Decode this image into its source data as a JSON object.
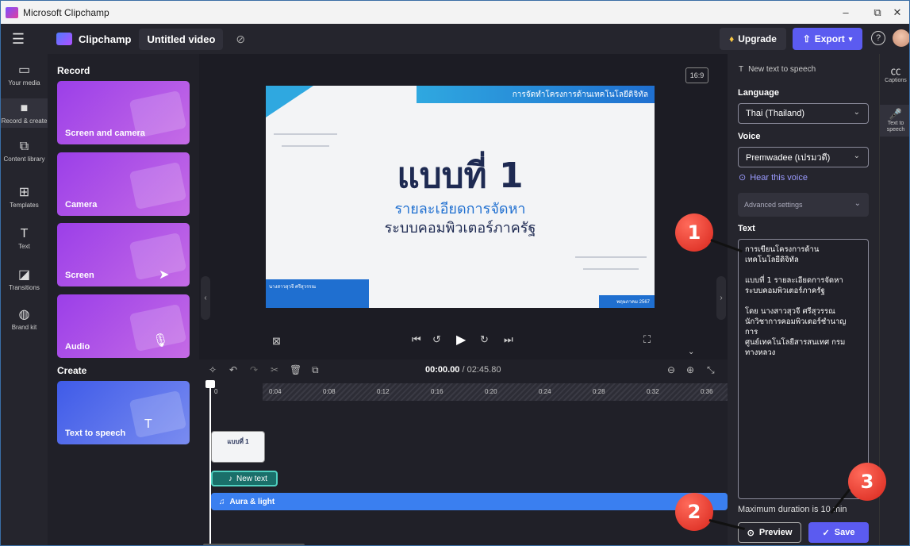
{
  "window": {
    "title": "Microsoft Clipchamp",
    "min": "–",
    "max": "⧉",
    "close": "✕"
  },
  "appbar": {
    "brand": "Clipchamp",
    "video_title": "Untitled video",
    "upgrade": "Upgrade",
    "export": "Export"
  },
  "left_rail": [
    {
      "label": "Your media",
      "icon": "folder-icon"
    },
    {
      "label": "Record & create",
      "icon": "camera-icon"
    },
    {
      "label": "Content library",
      "icon": "library-icon"
    },
    {
      "label": "Templates",
      "icon": "templates-icon"
    },
    {
      "label": "Text",
      "icon": "text-icon"
    },
    {
      "label": "Transitions",
      "icon": "transitions-icon"
    },
    {
      "label": "Brand kit",
      "icon": "brand-kit-icon"
    }
  ],
  "record_panel": {
    "record_heading": "Record",
    "cards": [
      "Screen and camera",
      "Camera",
      "Screen",
      "Audio"
    ],
    "create_heading": "Create",
    "create_card": "Text to speech"
  },
  "canvas": {
    "ratio": "16:9",
    "slide": {
      "banner": "การจัดทำโครงการด้านเทคโนโลยีดิจิทัล",
      "title": "แบบที่ 1",
      "line1": "รายละเอียดการจัดหา",
      "line2": "ระบบคอมพิวเตอร์ภาครัฐ",
      "author": "นางสาวสุวจี ศรีสุวรรณ",
      "date": "พฤษภาคม 2567"
    }
  },
  "timeline": {
    "current": "00:00.00",
    "total": "/ 02:45.80",
    "ticks": [
      "0",
      "0:04",
      "0:08",
      "0:12",
      "0:16",
      "0:20",
      "0:24",
      "0:28",
      "0:32",
      "0:36"
    ],
    "video_clip_title": "แบบที่ 1",
    "tts_clip": "New text",
    "audio_clip": "Aura & light"
  },
  "tts_panel": {
    "header": "New text to speech",
    "language_label": "Language",
    "language_value": "Thai (Thailand)",
    "voice_label": "Voice",
    "voice_value": "Premwadee (เปรมวดี)",
    "hear": "Hear this voice",
    "advanced": "Advanced settings",
    "text_label": "Text",
    "text_value": "การเขียนโครงการด้าน\nเทคโนโลยีดิจิทัล\n\nแบบที่ 1 รายละเอียดการจัดหา\nระบบคอมพิวเตอร์ภาครัฐ\n\nโดย นางสาวสุวจี ศรีสุวรรณ\nนักวิชาการคอมพิวเตอร์ชำนาญ\nการ\nศูนย์เทคโนโลยีสารสนเทศ กรม\nทางหลวง",
    "max_duration": "Maximum duration is 10 min",
    "preview": "Preview",
    "save": "Save"
  },
  "right_rail": [
    {
      "label": "Captions"
    },
    {
      "label": "Text to speech"
    }
  ],
  "badges": [
    "1",
    "2",
    "3"
  ],
  "colors": {
    "accent": "#5b5bf0",
    "badge": "#e0302a"
  }
}
